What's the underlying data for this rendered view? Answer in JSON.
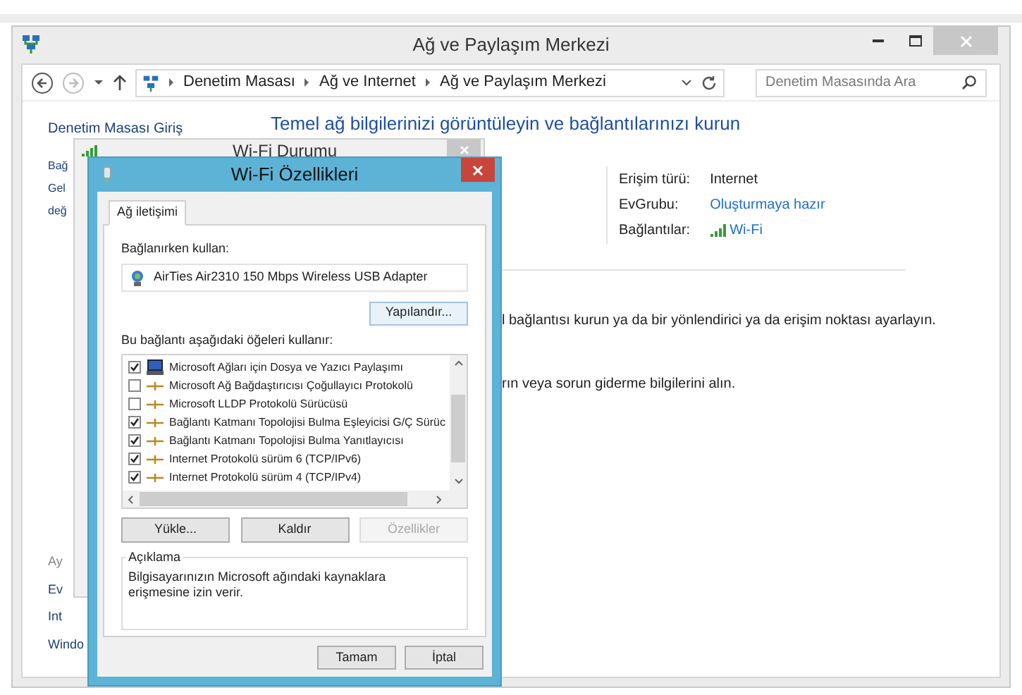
{
  "window": {
    "title": "Ağ ve Paylaşım Merkezi"
  },
  "address_bar": {
    "breadcrumbs": [
      "Denetim Masası",
      "Ağ ve Internet",
      "Ağ ve Paylaşım Merkezi"
    ],
    "search_placeholder": "Denetim Masasında Ara"
  },
  "sidebar": {
    "home_link": "Denetim Masası Giriş",
    "top_items": [
      "Bağ",
      "Gel",
      "değ"
    ],
    "bottom_items": [
      "Ay",
      "Ev",
      "Int",
      "Windo"
    ]
  },
  "heading": "Temel ağ bilgilerinizi görüntüleyin ve bağlantılarınızı kurun",
  "network_info": [
    {
      "label": "Erişim türü:",
      "value": "Internet",
      "kind": "text"
    },
    {
      "label": "EvGrubu:",
      "value": "Oluşturmaya hazır",
      "kind": "link"
    },
    {
      "label": "Bağlantılar:",
      "value": "Wi-Fi",
      "kind": "wifi"
    }
  ],
  "task_texts": [
    "l bağlantısı kurun ya da bir yönlendirici ya da erişim noktası ayarlayın.",
    "rın veya sorun giderme bilgilerini alın."
  ],
  "status_dialog": {
    "title": "Wi-Fi Durumu"
  },
  "properties_dialog": {
    "title": "Wi-Fi Özellikleri",
    "tabs": [
      {
        "label": "Ağ iletişimi",
        "selected": true
      }
    ],
    "connect_using_label": "Bağlanırken kullan:",
    "adapter": "AirTies Air2310 150 Mbps Wireless USB Adapter",
    "configure_button": "Yapılandır...",
    "items_label": "Bu bağlantı aşağıdaki öğeleri kullanır:",
    "items": [
      {
        "label": "Microsoft Ağları için Dosya ve Yazıcı Paylaşımı",
        "checked": true,
        "kind": "service"
      },
      {
        "label": "Microsoft Ağ Bağdaştırıcısı Çoğullayıcı Protokolü",
        "checked": false,
        "kind": "protocol"
      },
      {
        "label": "Microsoft LLDP Protokolü Sürücüsü",
        "checked": false,
        "kind": "protocol"
      },
      {
        "label": "Bağlantı Katmanı Topolojisi Bulma Eşleyicisi G/Ç Sürüc",
        "checked": true,
        "kind": "protocol"
      },
      {
        "label": "Bağlantı Katmanı Topolojisi Bulma Yanıtlayıcısı",
        "checked": true,
        "kind": "protocol"
      },
      {
        "label": "Internet Protokolü sürüm 6 (TCP/IPv6)",
        "checked": true,
        "kind": "protocol"
      },
      {
        "label": "Internet Protokolü sürüm 4 (TCP/IPv4)",
        "checked": true,
        "kind": "protocol"
      }
    ],
    "item_buttons": [
      {
        "label": "Yükle...",
        "disabled": false
      },
      {
        "label": "Kaldır",
        "disabled": false
      },
      {
        "label": "Özellikler",
        "disabled": true
      }
    ],
    "description_title": "Açıklama",
    "description": "Bilgisayarınızın Microsoft ağındaki kaynaklara erişmesine izin verir.",
    "buttons": [
      "Tamam",
      "İptal"
    ]
  }
}
